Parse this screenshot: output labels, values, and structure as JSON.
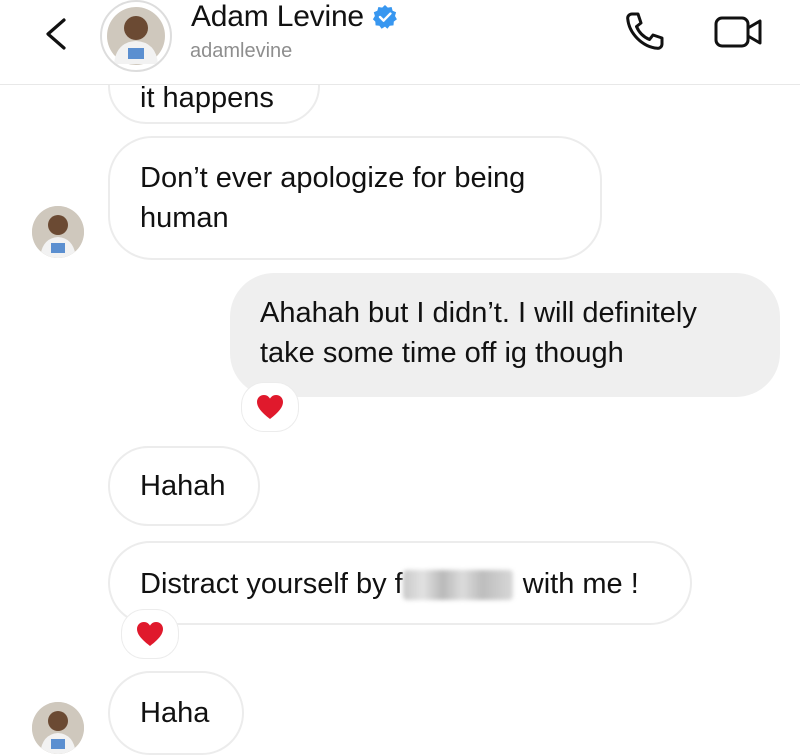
{
  "header": {
    "name": "Adam Levine",
    "handle": "adamlevine",
    "icons": {
      "back": "chevron-left-icon",
      "verified": "verified-badge-icon",
      "call": "phone-icon",
      "video": "video-camera-icon"
    }
  },
  "messages": [
    {
      "direction": "incoming",
      "text": "it happens"
    },
    {
      "direction": "incoming",
      "text": "Don’t ever apologize for being\nhuman"
    },
    {
      "direction": "outgoing",
      "text": "Ahahah but I didn’t. I will definitely\ntake some time off ig though",
      "reaction": "❤️"
    },
    {
      "direction": "incoming",
      "text": "Hahah"
    },
    {
      "direction": "incoming",
      "text_before": "Distract yourself by f",
      "text_after": " with me !",
      "reaction": "❤️"
    },
    {
      "direction": "incoming",
      "text": "Haha"
    }
  ],
  "colors": {
    "verified": "#3897f0",
    "outgoing_bubble": "#efefef",
    "bubble_border": "#ececec",
    "secondary_text": "#8e8e8e",
    "heart": "#e0192c"
  }
}
